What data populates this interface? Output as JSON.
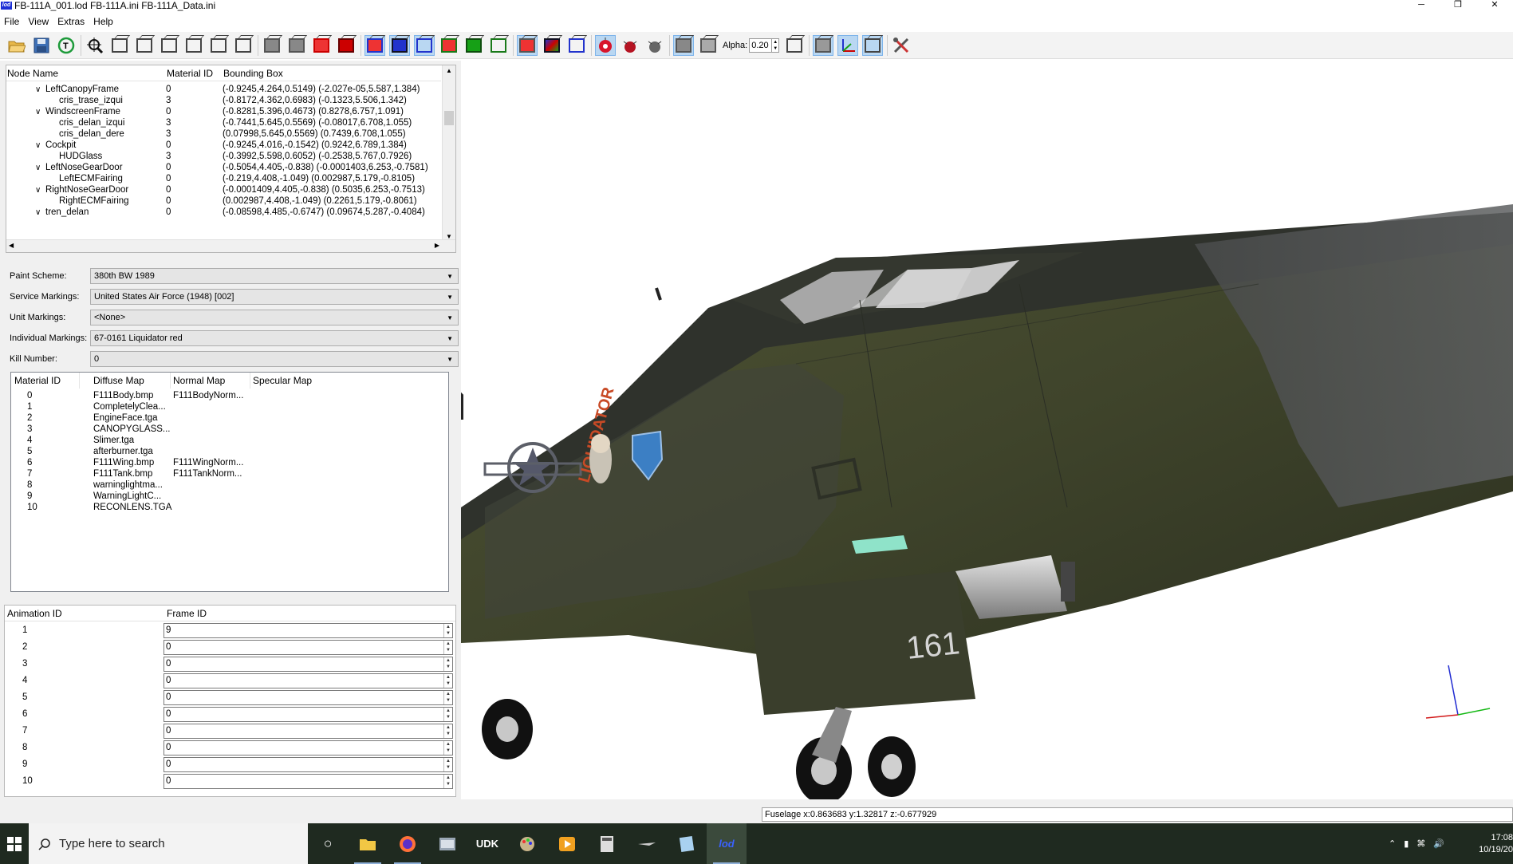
{
  "window": {
    "title": "FB-111A_001.lod  FB-111A.ini  FB-111A_Data.ini",
    "app_icon_text": "lod"
  },
  "menu": [
    "File",
    "View",
    "Extras",
    "Help"
  ],
  "toolbar": {
    "alpha_label": "Alpha:",
    "alpha_value": "0.20"
  },
  "tree": {
    "columns": [
      "Node Name",
      "Material ID",
      "Bounding Box"
    ],
    "rows": [
      {
        "name": "LeftCanopyFrame",
        "indent": 1,
        "expanded": true,
        "mat": "0",
        "bbox": "(-0.9245,4.264,0.5149) (-2.027e-05,5.587,1.384)"
      },
      {
        "name": "cris_trase_izqui",
        "indent": 2,
        "expanded": false,
        "mat": "3",
        "bbox": "(-0.8172,4.362,0.6983) (-0.1323,5.506,1.342)"
      },
      {
        "name": "WindscreenFrame",
        "indent": 1,
        "expanded": true,
        "mat": "0",
        "bbox": "(-0.8281,5.396,0.4673) (0.8278,6.757,1.091)"
      },
      {
        "name": "cris_delan_izqui",
        "indent": 2,
        "expanded": false,
        "mat": "3",
        "bbox": "(-0.7441,5.645,0.5569) (-0.08017,6.708,1.055)"
      },
      {
        "name": "cris_delan_dere",
        "indent": 2,
        "expanded": false,
        "mat": "3",
        "bbox": "(0.07998,5.645,0.5569) (0.7439,6.708,1.055)"
      },
      {
        "name": "Cockpit",
        "indent": 1,
        "expanded": true,
        "mat": "0",
        "bbox": "(-0.9245,4.016,-0.1542) (0.9242,6.789,1.384)"
      },
      {
        "name": "HUDGlass",
        "indent": 2,
        "expanded": false,
        "mat": "3",
        "bbox": "(-0.3992,5.598,0.6052) (-0.2538,5.767,0.7926)"
      },
      {
        "name": "LeftNoseGearDoor",
        "indent": 1,
        "expanded": true,
        "mat": "0",
        "bbox": "(-0.5054,4.405,-0.838) (-0.0001403,6.253,-0.7581)"
      },
      {
        "name": "LeftECMFairing",
        "indent": 2,
        "expanded": false,
        "mat": "0",
        "bbox": "(-0.219,4.408,-1.049) (0.002987,5.179,-0.8105)"
      },
      {
        "name": "RightNoseGearDoor",
        "indent": 1,
        "expanded": true,
        "mat": "0",
        "bbox": "(-0.0001409,4.405,-0.838) (0.5035,6.253,-0.7513)"
      },
      {
        "name": "RightECMFairing",
        "indent": 2,
        "expanded": false,
        "mat": "0",
        "bbox": "(0.002987,4.408,-1.049) (0.2261,5.179,-0.8061)"
      },
      {
        "name": "tren_delan",
        "indent": 1,
        "expanded": true,
        "mat": "0",
        "bbox": "(-0.08598,4.485,-0.6747) (0.09674,5.287,-0.4084)"
      }
    ]
  },
  "settings": {
    "paint_scheme": {
      "label": "Paint Scheme:",
      "value": "380th BW 1989"
    },
    "service_markings": {
      "label": "Service Markings:",
      "value": "United States Air Force (1948) [002]"
    },
    "unit_markings": {
      "label": "Unit Markings:",
      "value": "<None>"
    },
    "individual_markings": {
      "label": "Individual Markings:",
      "value": "67-0161 Liquidator  red"
    },
    "kill_number": {
      "label": "Kill Number:",
      "value": "0"
    }
  },
  "materials": {
    "columns": [
      "Material ID",
      "Diffuse Map",
      "Normal Map",
      "Specular Map"
    ],
    "rows": [
      {
        "id": "0",
        "diffuse": "F111Body.bmp",
        "normal": "F111BodyNorm...",
        "specular": ""
      },
      {
        "id": "1",
        "diffuse": "CompletelyClea...",
        "normal": "",
        "specular": ""
      },
      {
        "id": "2",
        "diffuse": "EngineFace.tga",
        "normal": "",
        "specular": ""
      },
      {
        "id": "3",
        "diffuse": "CANOPYGLASS...",
        "normal": "",
        "specular": ""
      },
      {
        "id": "4",
        "diffuse": "Slimer.tga",
        "normal": "",
        "specular": ""
      },
      {
        "id": "5",
        "diffuse": "afterburner.tga",
        "normal": "",
        "specular": ""
      },
      {
        "id": "6",
        "diffuse": "F111Wing.bmp",
        "normal": "F111WingNorm...",
        "specular": ""
      },
      {
        "id": "7",
        "diffuse": "F111Tank.bmp",
        "normal": "F111TankNorm...",
        "specular": ""
      },
      {
        "id": "8",
        "diffuse": "warninglightma...",
        "normal": "",
        "specular": ""
      },
      {
        "id": "9",
        "diffuse": "WarningLightC...",
        "normal": "",
        "specular": ""
      },
      {
        "id": "10",
        "diffuse": "RECONLENS.TGA",
        "normal": "",
        "specular": ""
      }
    ]
  },
  "animations": {
    "columns": [
      "Animation ID",
      "Frame ID"
    ],
    "rows": [
      {
        "id": "1",
        "frame": "9"
      },
      {
        "id": "2",
        "frame": "0"
      },
      {
        "id": "3",
        "frame": "0"
      },
      {
        "id": "4",
        "frame": "0"
      },
      {
        "id": "5",
        "frame": "0"
      },
      {
        "id": "6",
        "frame": "0"
      },
      {
        "id": "7",
        "frame": "0"
      },
      {
        "id": "8",
        "frame": "0"
      },
      {
        "id": "9",
        "frame": "0"
      },
      {
        "id": "10",
        "frame": "0"
      }
    ]
  },
  "viewport": {
    "marking_text": "LIQUIDATOR",
    "tail_number": "161"
  },
  "status": {
    "text": "Fuselage    x:0.863683 y:1.32817 z:-0.677929"
  },
  "taskbar": {
    "search_placeholder": "Type here to search",
    "time": "17:08",
    "date": "10/19/20"
  }
}
